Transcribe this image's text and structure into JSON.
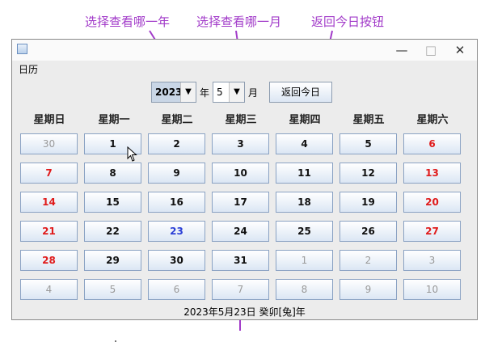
{
  "annotations": {
    "select_year": "选择查看哪一年",
    "select_month": "选择查看哪一月",
    "today_button": "返回今日按钮"
  },
  "window": {
    "title": "日历"
  },
  "controls": {
    "year": "2023",
    "year_label": "年",
    "month": "5",
    "month_label": "月",
    "today_label": "返回今日"
  },
  "weekdays": [
    "星期日",
    "星期一",
    "星期二",
    "星期三",
    "星期四",
    "星期五",
    "星期六"
  ],
  "days": [
    [
      "30",
      "1",
      "2",
      "3",
      "4",
      "5",
      "6"
    ],
    [
      "7",
      "8",
      "9",
      "10",
      "11",
      "12",
      "13"
    ],
    [
      "14",
      "15",
      "16",
      "17",
      "18",
      "19",
      "20"
    ],
    [
      "21",
      "22",
      "23",
      "24",
      "25",
      "26",
      "27"
    ],
    [
      "28",
      "29",
      "30",
      "31",
      "1",
      "2",
      "3"
    ],
    [
      "4",
      "5",
      "6",
      "7",
      "8",
      "9",
      "10"
    ]
  ],
  "lunar_text": "2023年5月23日 癸卯[兔]年",
  "colors": {
    "weekend": "#e01b1b",
    "today": "#2b3fd6",
    "other_month": "#9a9a9a",
    "annotation": "#a23bc9"
  }
}
